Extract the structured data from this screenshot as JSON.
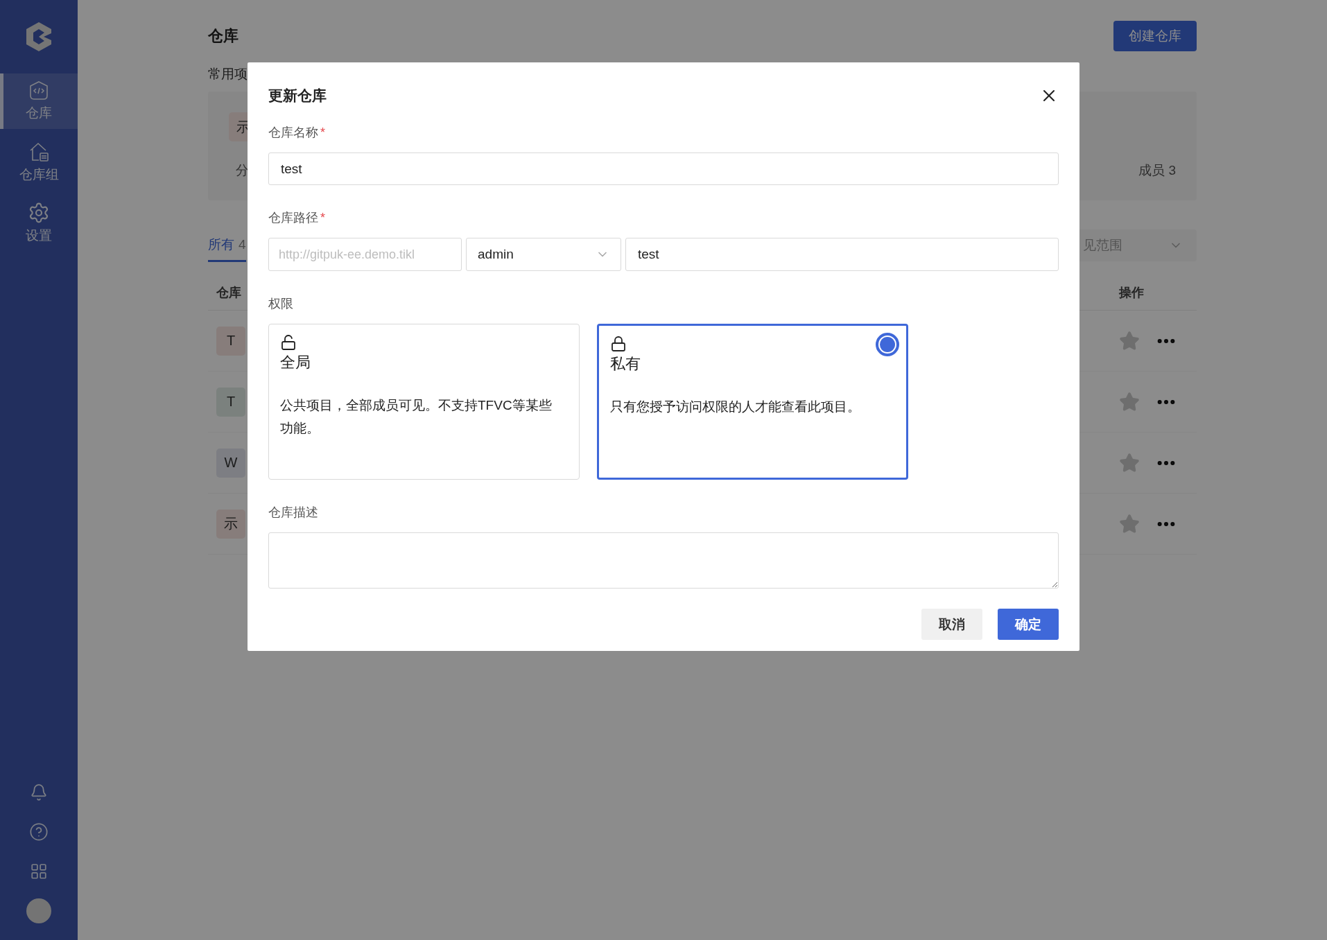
{
  "sidebar": {
    "items": [
      {
        "label": "仓库",
        "selected": true
      },
      {
        "label": "仓库组",
        "selected": false
      },
      {
        "label": "设置",
        "selected": false
      }
    ]
  },
  "page": {
    "title": "仓库",
    "create_button": "创建仓库",
    "section_label": "常用项",
    "favorite": {
      "avatar": "示",
      "meta": "分",
      "members": "成员 3"
    },
    "tabs": [
      {
        "label": "所有",
        "count": "4",
        "selected": true
      }
    ],
    "filter": {
      "placeholder": "见范围"
    },
    "table": {
      "columns": [
        "仓库",
        "操作"
      ],
      "rows": [
        {
          "avatar": "T"
        },
        {
          "avatar": "T"
        },
        {
          "avatar": "W"
        },
        {
          "avatar": "示"
        }
      ]
    }
  },
  "dialog": {
    "title": "更新仓库",
    "name_field": {
      "label": "仓库名称",
      "mark": "*",
      "value": "test"
    },
    "path_field": {
      "label": "仓库路径",
      "mark": "*",
      "prefix": "http://gitpuk-ee.demo.tikl",
      "owner": "admin",
      "value": "test"
    },
    "permission": {
      "label": "权限",
      "options": [
        {
          "kind": "public",
          "title": "全局",
          "description": "公共项目，全部成员可见。不支持TFVC等某些功能。",
          "selected": false
        },
        {
          "kind": "private",
          "title": "私有",
          "description": "只有您授予访问权限的人才能查看此项目。",
          "selected": true
        }
      ]
    },
    "description_field": {
      "label": "仓库描述"
    },
    "buttons": {
      "cancel": "取消",
      "ok": "确定"
    }
  }
}
